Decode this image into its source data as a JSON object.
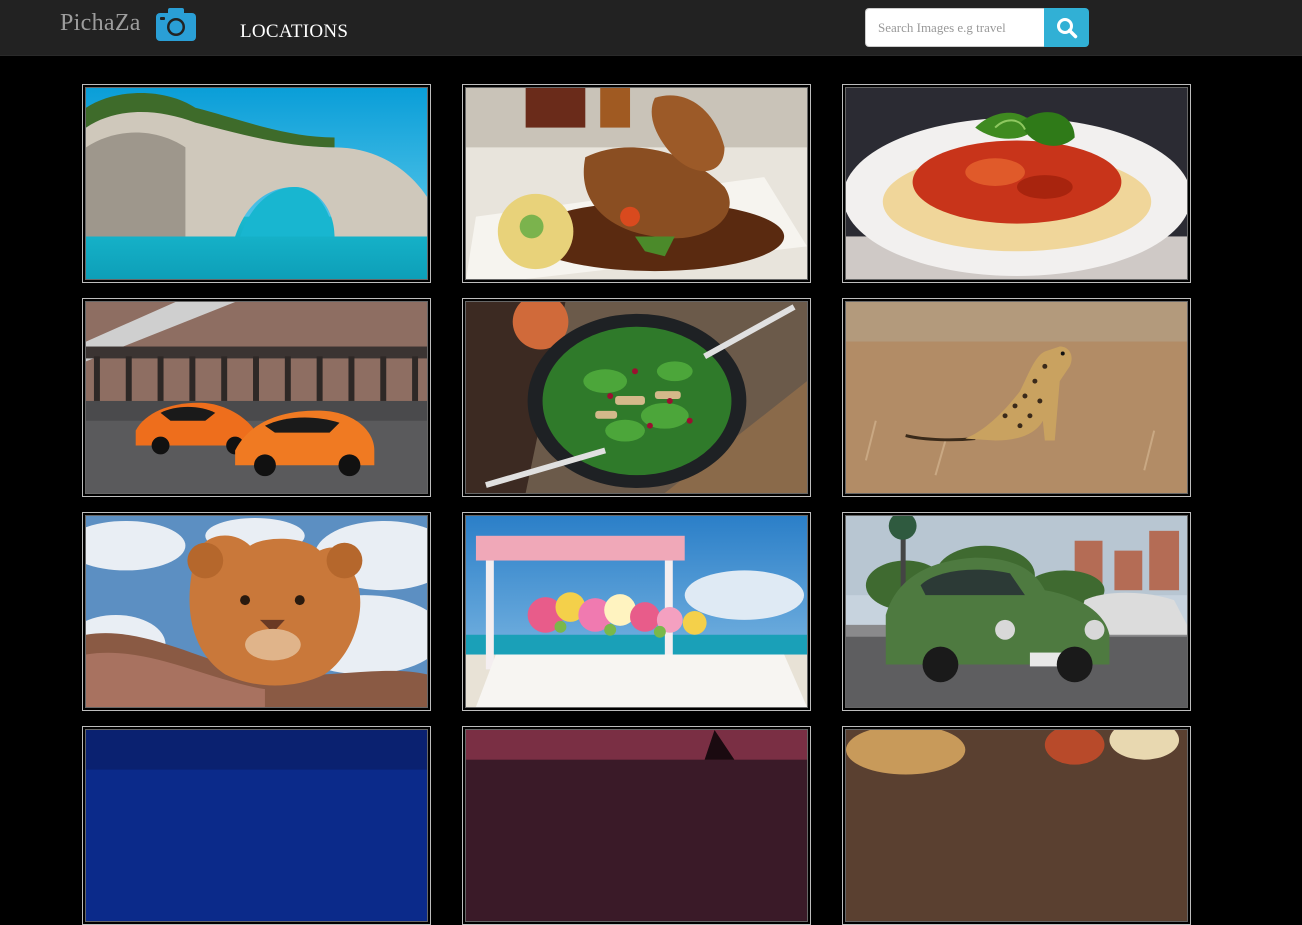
{
  "brand": {
    "name": "PichaZa",
    "logo_icon": "camera-icon",
    "logo_color": "#2a9fd6"
  },
  "nav": {
    "links": [
      {
        "label": "LOCATIONS"
      }
    ]
  },
  "search": {
    "placeholder": "Search Images e.g travel",
    "value": "",
    "button_icon": "search-icon",
    "button_color": "#31b0d5"
  },
  "gallery": {
    "images": [
      {
        "subject": "sea-arch-coast"
      },
      {
        "subject": "roast-chicken-plate"
      },
      {
        "subject": "spaghetti-bolognese"
      },
      {
        "subject": "orange-sports-cars"
      },
      {
        "subject": "spinach-salad-bowl"
      },
      {
        "subject": "cheetah-savanna"
      },
      {
        "subject": "lion-cub"
      },
      {
        "subject": "beach-wedding-table"
      },
      {
        "subject": "green-vintage-car"
      },
      {
        "subject": "night-sky"
      },
      {
        "subject": "sunset-palms"
      },
      {
        "subject": "food-platter"
      }
    ]
  }
}
